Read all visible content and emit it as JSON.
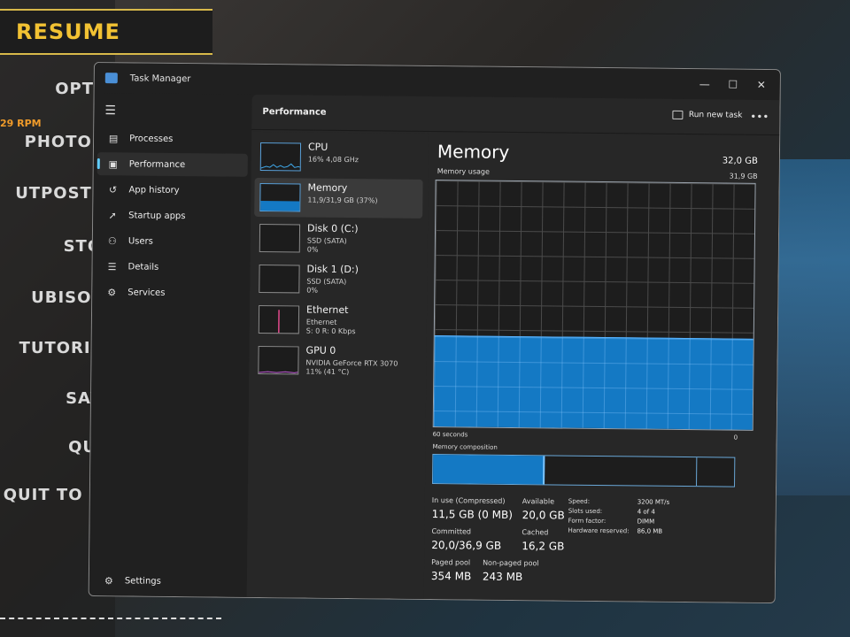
{
  "game_menu": {
    "resume": "RESUME",
    "items": [
      "OPTIO",
      "PHOTO M",
      "UTPOST M",
      "STOR",
      "UBISOFT",
      "TUTORIAL",
      "SAVE",
      "QUIT",
      "QUIT TO DE"
    ],
    "rpm": "29 RPM"
  },
  "window": {
    "title": "Task Manager",
    "controls": {
      "minimize": "—",
      "maximize": "☐",
      "close": "✕"
    }
  },
  "sidebar": {
    "menu_icon": "hamburger-icon",
    "items": [
      {
        "label": "Processes",
        "icon": "processes-icon",
        "glyph": "▤"
      },
      {
        "label": "Performance",
        "icon": "performance-icon",
        "glyph": "▣",
        "active": true
      },
      {
        "label": "App history",
        "icon": "history-icon",
        "glyph": "↺"
      },
      {
        "label": "Startup apps",
        "icon": "startup-icon",
        "glyph": "➚"
      },
      {
        "label": "Users",
        "icon": "users-icon",
        "glyph": "⚇"
      },
      {
        "label": "Details",
        "icon": "details-icon",
        "glyph": "☰"
      },
      {
        "label": "Services",
        "icon": "services-icon",
        "glyph": "⚙"
      }
    ],
    "settings_label": "Settings",
    "settings_glyph": "⚙"
  },
  "header": {
    "title": "Performance",
    "run_new_task": "Run new task",
    "more": "•••"
  },
  "perf_list": [
    {
      "name": "CPU",
      "sub1": "16% 4,08 GHz",
      "sub2": "",
      "sub3": ""
    },
    {
      "name": "Memory",
      "sub1": "11,9/31,9 GB (37%)",
      "sub2": "",
      "sub3": "",
      "selected": true
    },
    {
      "name": "Disk 0 (C:)",
      "sub1": "SSD (SATA)",
      "sub2": "0%",
      "sub3": ""
    },
    {
      "name": "Disk 1 (D:)",
      "sub1": "SSD (SATA)",
      "sub2": "0%",
      "sub3": ""
    },
    {
      "name": "Ethernet",
      "sub1": "Ethernet",
      "sub2": "S: 0 R: 0 Kbps",
      "sub3": ""
    },
    {
      "name": "GPU 0",
      "sub1": "NVIDIA GeForce RTX 3070",
      "sub2": "11% (41 °C)",
      "sub3": ""
    }
  ],
  "detail": {
    "title": "Memory",
    "total": "32,0 GB",
    "usage_label": "Memory usage",
    "usage_max": "31,9 GB",
    "usage_fraction": 0.37,
    "axis_left": "60 seconds",
    "axis_right": "0",
    "composition_label": "Memory composition",
    "stats": {
      "in_use_label": "In use (Compressed)",
      "in_use": "11,5 GB (0 MB)",
      "available_label": "Available",
      "available": "20,0 GB",
      "committed_label": "Committed",
      "committed": "20,0/36,9 GB",
      "cached_label": "Cached",
      "cached": "16,2 GB",
      "paged_label": "Paged pool",
      "paged": "354 MB",
      "nonpaged_label": "Non-paged pool",
      "nonpaged": "243 MB"
    },
    "specs": {
      "speed_label": "Speed:",
      "speed": "3200 MT/s",
      "slots_label": "Slots used:",
      "slots": "4 of 4",
      "form_label": "Form factor:",
      "form": "DIMM",
      "reserved_label": "Hardware reserved:",
      "reserved": "86,0 MB"
    }
  },
  "colors": {
    "accent": "#1479c4",
    "sidebar_active": "#60cdff"
  }
}
